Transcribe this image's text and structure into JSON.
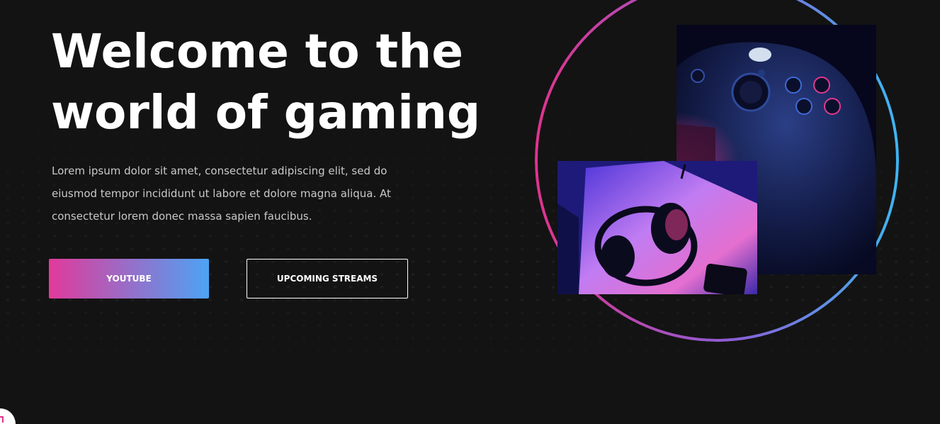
{
  "hero": {
    "title_line1": "Welcome to the",
    "title_line2": "world of gaming",
    "description": "Lorem ipsum dolor sit amet, consectetur adipiscing elit, sed do eiusmod tempor incididunt ut labore et dolore magna aliqua. At consectetur lorem donec massa sapien faucibus."
  },
  "buttons": {
    "youtube_label": "YOUTUBE",
    "streams_label": "UPCOMING STREAMS"
  },
  "colors": {
    "background": "#131313",
    "accent_pink": "#e13a9b",
    "accent_blue": "#4da3f5",
    "text_primary": "#ffffff",
    "text_secondary": "#c9c9c9"
  },
  "images": {
    "top_right": "game-controller-photo",
    "bottom_left": "gaming-headset-photo"
  },
  "icons": {
    "corner": "brand-badge-icon"
  }
}
